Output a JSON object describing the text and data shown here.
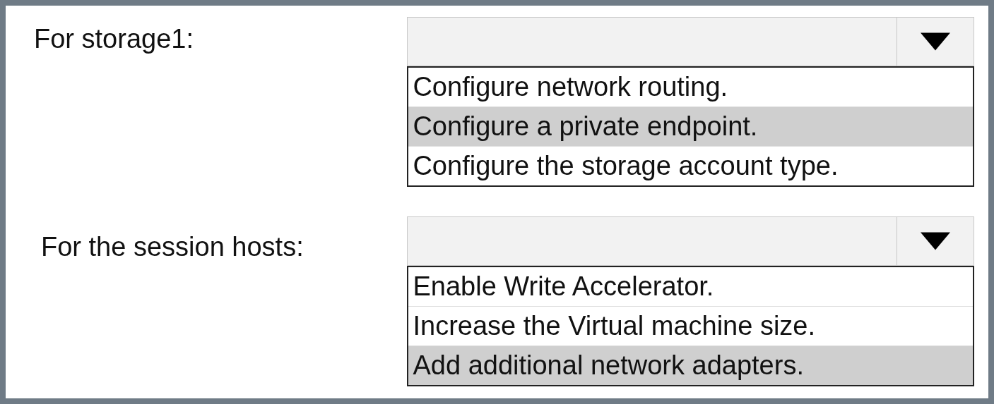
{
  "questions": [
    {
      "label": "For storage1:",
      "options": [
        {
          "text": "Configure network routing.",
          "selected": false
        },
        {
          "text": "Configure a private endpoint.",
          "selected": true
        },
        {
          "text": "Configure the storage account type.",
          "selected": false
        }
      ]
    },
    {
      "label": "For the session hosts:",
      "options": [
        {
          "text": "Enable Write Accelerator.",
          "selected": false
        },
        {
          "text": "Increase the Virtual machine size.",
          "selected": false
        },
        {
          "text": "Add additional network adapters.",
          "selected": true
        }
      ]
    }
  ]
}
